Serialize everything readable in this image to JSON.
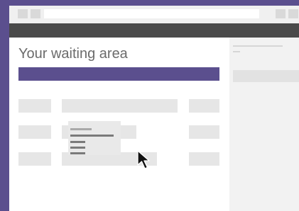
{
  "page": {
    "title": "Your waiting area"
  },
  "colors": {
    "accent": "#5b4f8e",
    "toolbar": "#4a4a4a",
    "placeholder": "#e6e6e6",
    "sidebar": "#f2f2f2"
  },
  "icons": {
    "cursor": "mouse-pointer-icon"
  }
}
